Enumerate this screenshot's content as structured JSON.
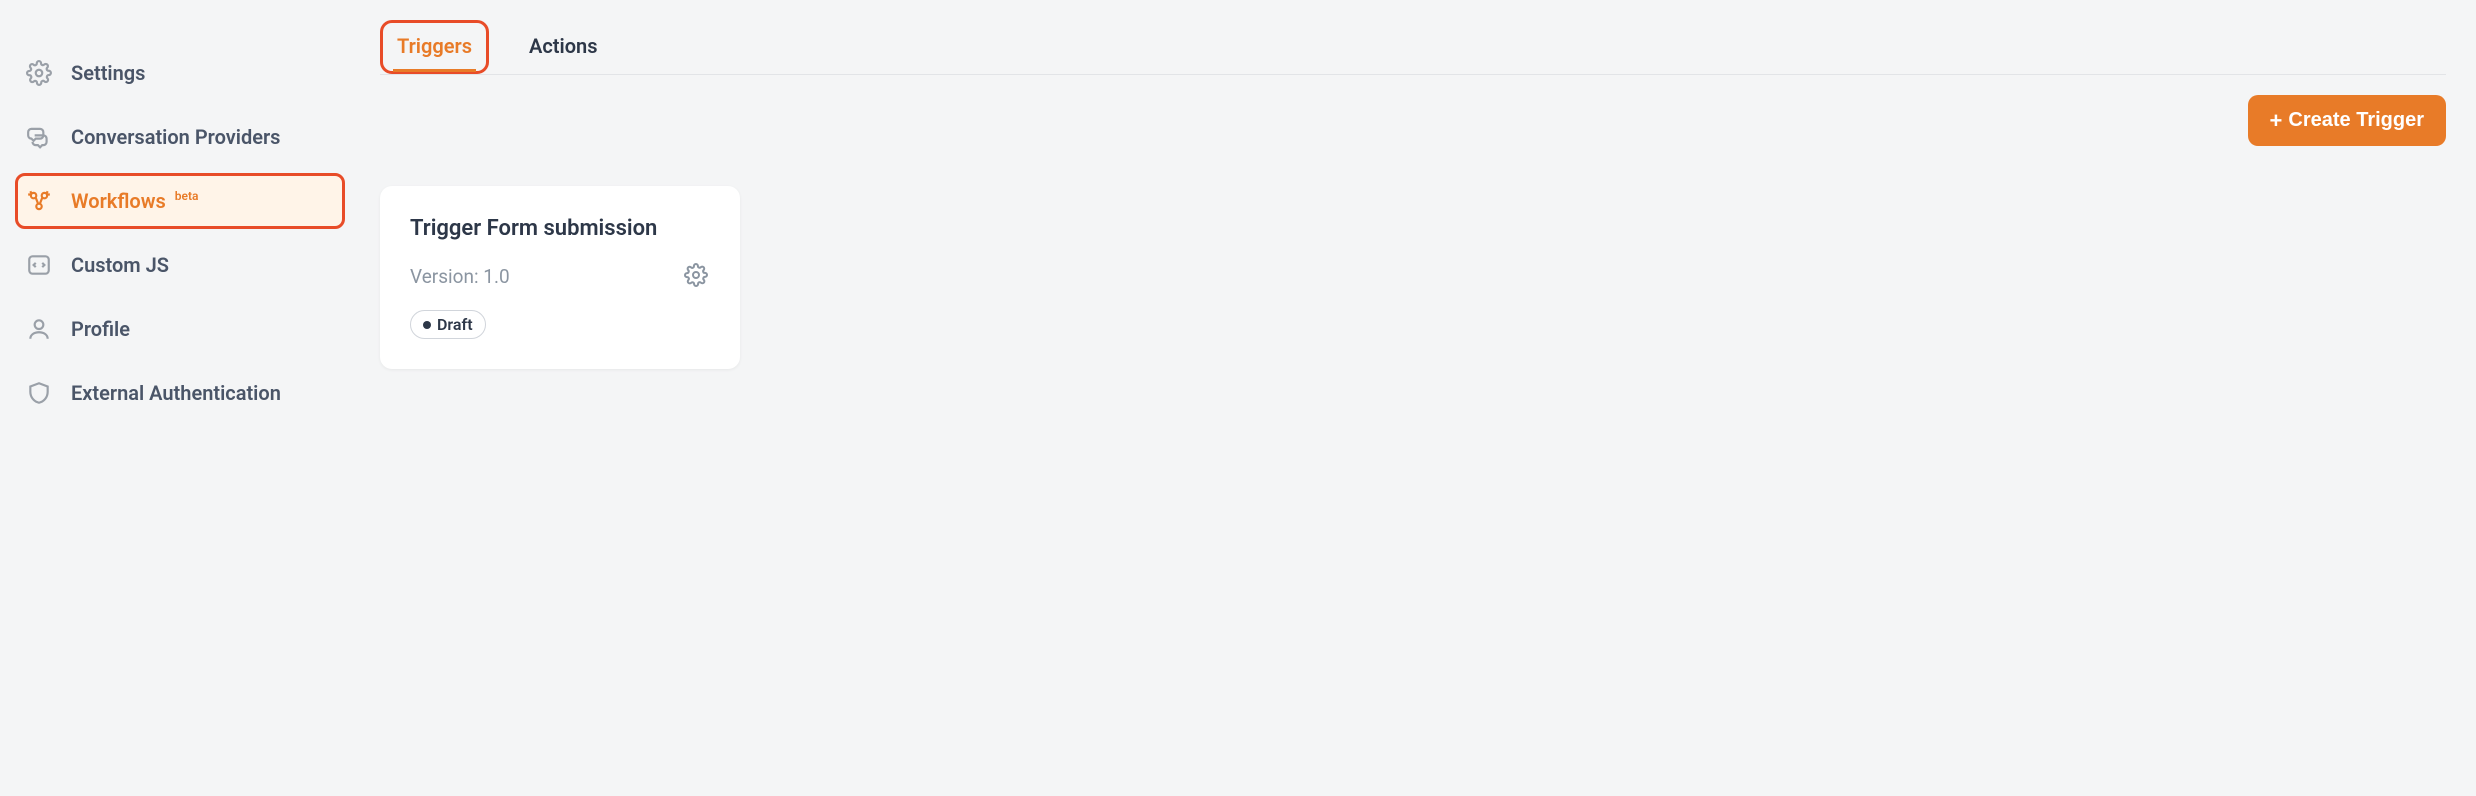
{
  "sidebar": {
    "items": [
      {
        "label": "Settings",
        "icon": "gear"
      },
      {
        "label": "Conversation Providers",
        "icon": "chat"
      },
      {
        "label": "Workflows",
        "icon": "workflow",
        "badge": "beta",
        "active": true
      },
      {
        "label": "Custom JS",
        "icon": "code"
      },
      {
        "label": "Profile",
        "icon": "user"
      },
      {
        "label": "External Authentication",
        "icon": "shield"
      }
    ]
  },
  "tabs": [
    {
      "label": "Triggers",
      "active": true
    },
    {
      "label": "Actions",
      "active": false
    }
  ],
  "toolbar": {
    "create_label": "Create Trigger"
  },
  "cards": [
    {
      "title": "Trigger Form submission",
      "version_label": "Version: 1.0",
      "status": "Draft"
    }
  ],
  "colors": {
    "accent": "#e87b28",
    "highlight_border": "#e84c28"
  }
}
